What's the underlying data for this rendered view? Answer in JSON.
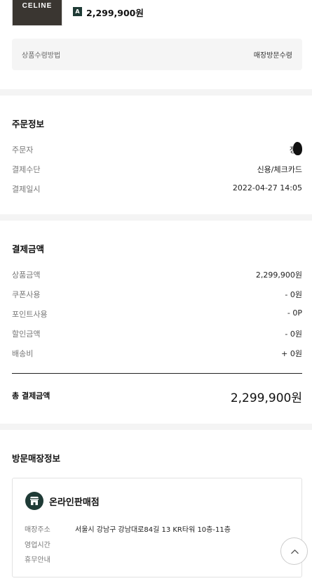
{
  "product": {
    "brand_logo_text": "CELINE",
    "badge": "A",
    "price": "2,299,900원"
  },
  "pickup": {
    "label": "상품수령방법",
    "value": "매장방문수령"
  },
  "order_info": {
    "title": "주문정보",
    "rows": [
      {
        "label": "주문자",
        "value": "장"
      },
      {
        "label": "결제수단",
        "value": "신용/체크카드"
      },
      {
        "label": "결제일시",
        "value": "2022-04-27 14:05"
      }
    ]
  },
  "payment": {
    "title": "결제금액",
    "rows": [
      {
        "label": "상품금액",
        "value": "2,299,900원"
      },
      {
        "label": "쿠폰사용",
        "value": "- 0원"
      },
      {
        "label": "포인트사용",
        "value": "- 0P"
      },
      {
        "label": "할인금액",
        "value": "- 0원"
      },
      {
        "label": "배송비",
        "value": "+ 0원"
      }
    ],
    "total_label": "총 결제금액",
    "total_value": "2,299,900원"
  },
  "store": {
    "section_title": "방문매장정보",
    "name": "온라인판매점",
    "icon": "store-icon",
    "rows": [
      {
        "label": "매장주소",
        "value": "서울시 강남구 강남대로84길 13 KR타워 10층-11층"
      },
      {
        "label": "영업시간",
        "value": ""
      },
      {
        "label": "휴무안내",
        "value": ""
      }
    ]
  },
  "scroll_top_icon": "chevron-up-icon"
}
